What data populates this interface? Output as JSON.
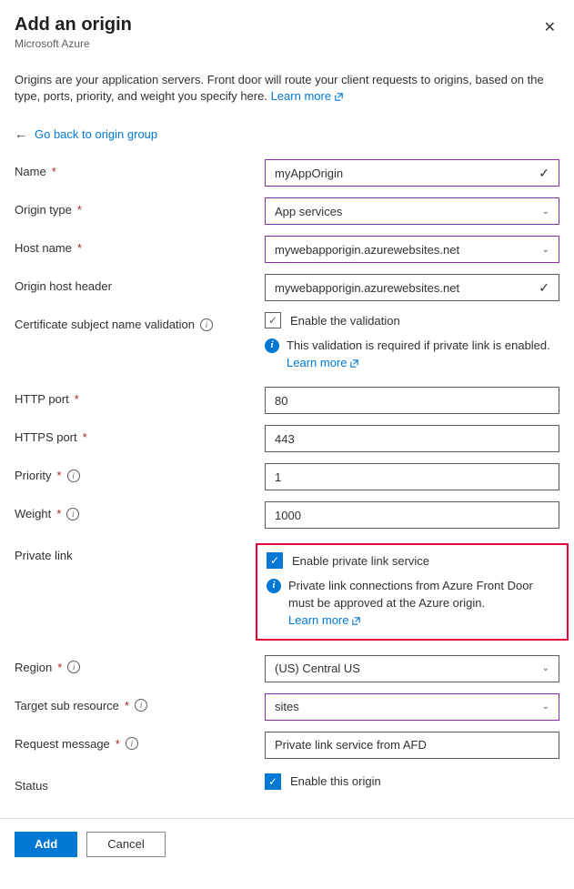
{
  "header": {
    "title": "Add an origin",
    "subtitle": "Microsoft Azure"
  },
  "intro": {
    "text": "Origins are your application servers. Front door will route your client requests to origins, based on the type, ports, priority, and weight you specify here. ",
    "learn_more": "Learn more"
  },
  "back_link": "Go back to origin group",
  "fields": {
    "name": {
      "label": "Name",
      "value": "myAppOrigin"
    },
    "origin_type": {
      "label": "Origin type",
      "value": "App services"
    },
    "host_name": {
      "label": "Host name",
      "value": "mywebapporigin.azurewebsites.net"
    },
    "origin_host_header": {
      "label": "Origin host header",
      "value": "mywebapporigin.azurewebsites.net"
    },
    "cert_validation": {
      "label": "Certificate subject name validation",
      "checkbox_label": "Enable the validation",
      "info_text": "This validation is required if private link is enabled. ",
      "learn_more": "Learn more"
    },
    "http_port": {
      "label": "HTTP port",
      "value": "80"
    },
    "https_port": {
      "label": "HTTPS port",
      "value": "443"
    },
    "priority": {
      "label": "Priority",
      "value": "1"
    },
    "weight": {
      "label": "Weight",
      "value": "1000"
    },
    "private_link": {
      "label": "Private link",
      "checkbox_label": "Enable private link service",
      "info_text": "Private link connections from Azure Front Door must be approved at the Azure origin.",
      "learn_more": "Learn more"
    },
    "region": {
      "label": "Region",
      "value": "(US) Central US"
    },
    "target_sub_resource": {
      "label": "Target sub resource",
      "value": "sites"
    },
    "request_message": {
      "label": "Request message",
      "value": "Private link service from AFD"
    },
    "status": {
      "label": "Status",
      "checkbox_label": "Enable this origin"
    }
  },
  "footer": {
    "add": "Add",
    "cancel": "Cancel"
  }
}
